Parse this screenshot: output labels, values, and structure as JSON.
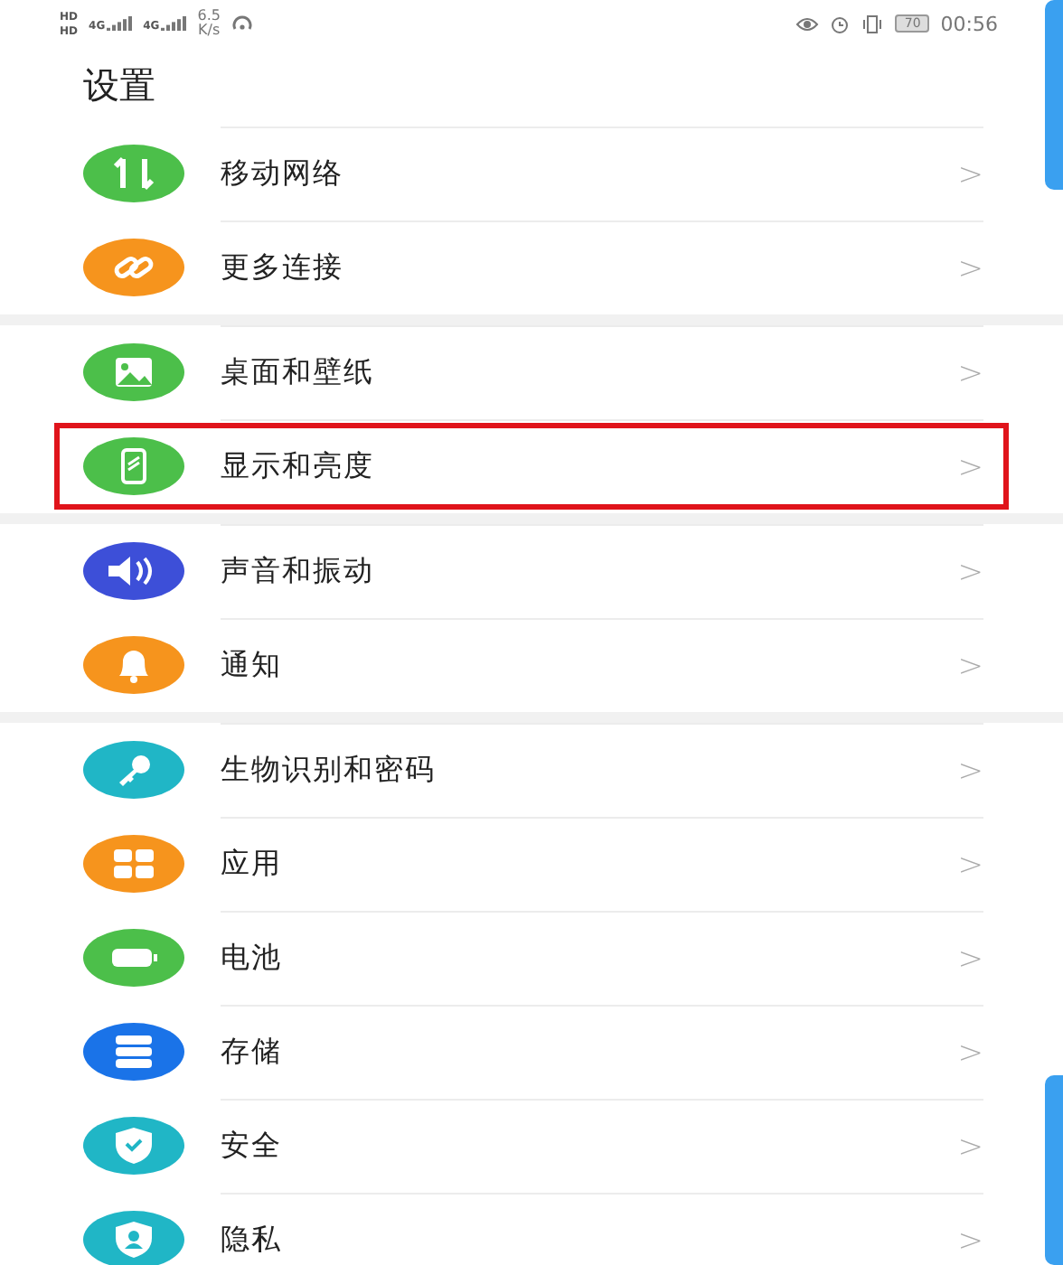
{
  "status_bar": {
    "sim": [
      "HD",
      "HD"
    ],
    "network": [
      "4G",
      "4G"
    ],
    "speed": "6.5",
    "speed_unit": "K/s",
    "battery": "70",
    "time": "00:56"
  },
  "title": "设置",
  "groups": [
    {
      "items": [
        {
          "label": "移动网络",
          "kind": "data",
          "color": "#4cbf4a",
          "highlighted": false
        },
        {
          "label": "更多连接",
          "kind": "link",
          "color": "#f6941d",
          "highlighted": false
        }
      ]
    },
    {
      "items": [
        {
          "label": "桌面和壁纸",
          "kind": "image",
          "color": "#4cbf4a",
          "highlighted": false
        },
        {
          "label": "显示和亮度",
          "kind": "display",
          "color": "#4cbf4a",
          "highlighted": true
        }
      ]
    },
    {
      "items": [
        {
          "label": "声音和振动",
          "kind": "sound",
          "color": "#3d4fd8",
          "highlighted": false
        },
        {
          "label": "通知",
          "kind": "bell",
          "color": "#f6941d",
          "highlighted": false
        }
      ]
    },
    {
      "items": [
        {
          "label": "生物识别和密码",
          "kind": "key",
          "color": "#20b6c6",
          "highlighted": false
        },
        {
          "label": "应用",
          "kind": "apps",
          "color": "#f6941d",
          "highlighted": false
        },
        {
          "label": "电池",
          "kind": "battery",
          "color": "#4cbf4a",
          "highlighted": false
        },
        {
          "label": "存储",
          "kind": "storage",
          "color": "#1a73e8",
          "highlighted": false
        },
        {
          "label": "安全",
          "kind": "shield",
          "color": "#20b6c6",
          "highlighted": false
        },
        {
          "label": "隐私",
          "kind": "privacy",
          "color": "#20b6c6",
          "highlighted": false
        }
      ]
    }
  ],
  "chevron": ">"
}
